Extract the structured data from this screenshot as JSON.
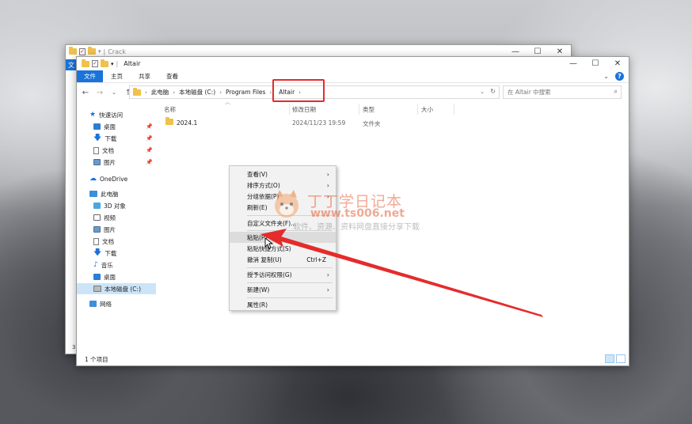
{
  "back_window": {
    "title": "Crack",
    "tab_letter": "文",
    "status_count": "3"
  },
  "window": {
    "title": "Altair",
    "controls": [
      "—",
      "☐",
      "✕"
    ]
  },
  "ribbon": {
    "tabs": [
      "文件",
      "主页",
      "共享",
      "查看"
    ],
    "help": "?"
  },
  "address": {
    "breadcrumbs": [
      "此电脑",
      "本地磁盘 (C:)",
      "Program Files",
      "Altair"
    ],
    "search_placeholder": "在 Altair 中搜索"
  },
  "nav_pane": {
    "quick_access": "快速访问",
    "quick_items": [
      "桌面",
      "下载",
      "文档",
      "图片"
    ],
    "onedrive": "OneDrive",
    "this_pc": "此电脑",
    "pc_items": [
      "3D 对象",
      "视频",
      "图片",
      "文档",
      "下载",
      "音乐",
      "桌面",
      "本地磁盘 (C:)"
    ],
    "network": "网络"
  },
  "columns": {
    "name": "名称",
    "date": "修改日期",
    "type": "类型",
    "size": "大小"
  },
  "files": [
    {
      "name": "2024.1",
      "date": "2024/11/23 19:59",
      "type": "文件夹",
      "size": ""
    }
  ],
  "status": {
    "count": "1 个项目"
  },
  "context_menu": {
    "items": [
      {
        "label": "查看(V)",
        "submenu": true
      },
      {
        "label": "排序方式(O)",
        "submenu": true
      },
      {
        "label": "分组依据(P)",
        "submenu": true
      },
      {
        "label": "刷新(E)",
        "submenu": false
      },
      {
        "label": "自定义文件夹(F)...",
        "submenu": false
      },
      {
        "label": "粘贴(P)",
        "submenu": false
      },
      {
        "label": "粘贴快捷方式(S)",
        "submenu": false
      },
      {
        "label": "撤消 复制(U)",
        "shortcut": "Ctrl+Z"
      },
      {
        "label": "授予访问权限(G)",
        "submenu": true
      },
      {
        "label": "新建(W)",
        "submenu": true
      },
      {
        "label": "属性(R)",
        "submenu": false
      }
    ]
  },
  "watermark": {
    "title": "丁丁学日记本",
    "url": "www.ts006.net",
    "subtitle": "软件、资源、资料网盘直接分享下载"
  },
  "colors": {
    "accent": "#1a73d9",
    "highlight_red": "#e52b2b",
    "folder": "#f0c14b",
    "selection": "#cce4f7"
  }
}
